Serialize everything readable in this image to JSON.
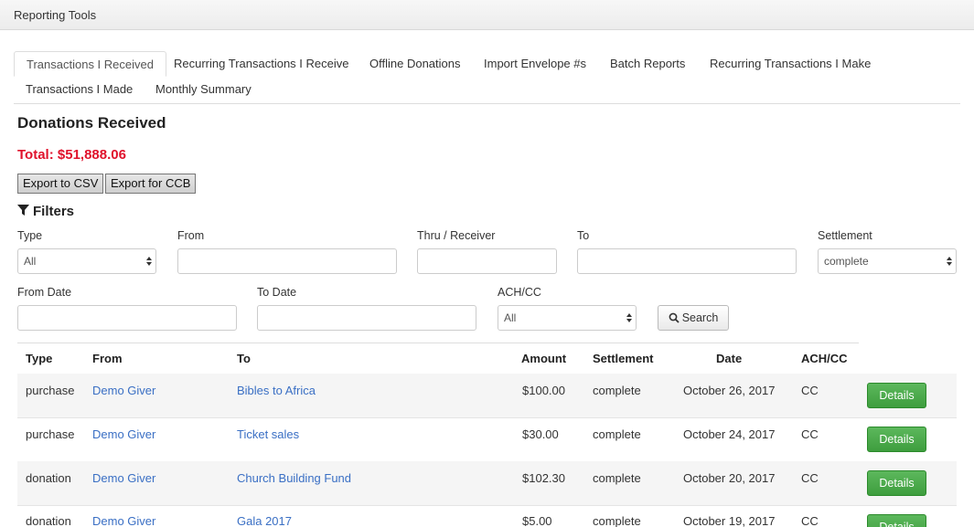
{
  "app": {
    "title": "Reporting Tools"
  },
  "tabs": [
    {
      "label": "Transactions I Received",
      "active": true
    },
    {
      "label": "Recurring Transactions I Receive"
    },
    {
      "label": "Offline Donations"
    },
    {
      "label": "Import Envelope #s"
    },
    {
      "label": "Batch Reports"
    },
    {
      "label": "Recurring Transactions I Make"
    },
    {
      "label": "Transactions I Made"
    },
    {
      "label": "Monthly Summary"
    }
  ],
  "page": {
    "title": "Donations Received",
    "total": "Total: $51,888.06"
  },
  "export": {
    "csv_label": "Export to CSV",
    "ccb_label": "Export for CCB"
  },
  "filters": {
    "heading": "Filters",
    "icon": "filter-icon",
    "type": {
      "label": "Type",
      "value": "All"
    },
    "from": {
      "label": "From",
      "value": ""
    },
    "thru_receiver": {
      "label": "Thru / Receiver",
      "value": ""
    },
    "to": {
      "label": "To",
      "value": ""
    },
    "settlement": {
      "label": "Settlement",
      "value": "complete"
    },
    "from_date": {
      "label": "From Date",
      "value": ""
    },
    "to_date": {
      "label": "To Date",
      "value": ""
    },
    "ach_cc": {
      "label": "ACH/CC",
      "value": "All"
    },
    "search_label": "Search"
  },
  "table": {
    "headers": [
      "Type",
      "From",
      "To",
      "Amount",
      "Settlement",
      "Date",
      "ACH/CC"
    ],
    "details_label": "Details",
    "rows": [
      {
        "type": "purchase",
        "from": "Demo Giver",
        "to": "Bibles to Africa",
        "amount": "$100.00",
        "settlement": "complete",
        "date": "October 26, 2017",
        "ach_cc": "CC"
      },
      {
        "type": "purchase",
        "from": "Demo Giver",
        "to": "Ticket sales",
        "amount": "$30.00",
        "settlement": "complete",
        "date": "October 24, 2017",
        "ach_cc": "CC"
      },
      {
        "type": "donation",
        "from": "Demo Giver",
        "to": "Church Building Fund",
        "amount": "$102.30",
        "settlement": "complete",
        "date": "October 20, 2017",
        "ach_cc": "CC"
      },
      {
        "type": "donation",
        "from": "Demo Giver",
        "to": "Gala 2017",
        "amount": "$5.00",
        "settlement": "complete",
        "date": "October 19, 2017",
        "ach_cc": "CC"
      }
    ]
  },
  "colors": {
    "total": "#e0112b",
    "link": "#3a6fc4",
    "details_button": "#4cae4c"
  }
}
